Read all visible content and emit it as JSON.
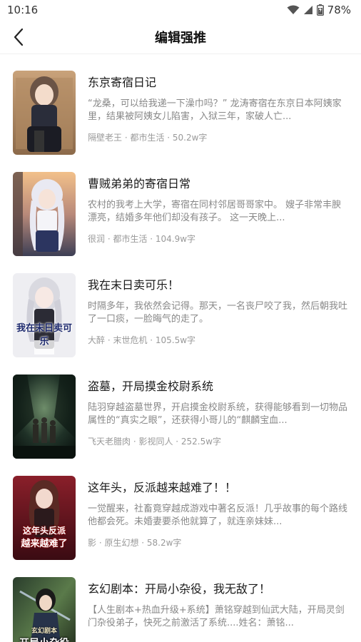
{
  "status": {
    "time": "10:16",
    "battery": "78%"
  },
  "nav": {
    "title": "编辑强推"
  },
  "books": [
    {
      "title": "东京寄宿日记",
      "desc": "“龙桑，可以给我递一下澡巾吗？” 龙涛寄宿在东京日本阿姨家里，结果被阿姨女儿陷害，入狱三年，家破人亡...",
      "meta": "隔壁老王 · 都市生活 · 50.2w字"
    },
    {
      "title": "曹贼弟弟的寄宿日常",
      "desc": "农村的我考上大学，寄宿在同村邻居哥哥家中。 嫂子非常丰腴漂亮，结婚多年他们却没有孩子。 这一天晚上...",
      "meta": "很润 · 都市生活 · 104.9w字"
    },
    {
      "title": "我在末日卖可乐！",
      "desc": "时隔多年，我依然会记得。那天，一名丧尸咬了我，然后朝我吐了一口痰，一脸晦气的走了。",
      "meta": "大醉 · 末世危机 · 105.5w字",
      "cover_text": "我在末日卖可乐"
    },
    {
      "title": "盗墓，开局摸金校尉系统",
      "desc": "陆羽穿越盗墓世界，开启摸金校尉系统，获得能够看到一切物品属性的“真实之眼”，还获得小哥儿的“麒麟宝血...",
      "meta": "飞天老腊肉 · 影视同人 · 252.5w字"
    },
    {
      "title": "这年头，反派越来越难了！！",
      "desc": "一觉醒来，社畜竟穿越成游戏中著名反派！几乎故事的每个路线他都会死。未婚妻要杀他就算了，就连亲妹妹...",
      "meta": "影 · 原生幻想 · 58.2w字",
      "cover_text_1": "这年头反派",
      "cover_text_2": "越来越难了"
    },
    {
      "title": "玄幻剧本：开局小杂役，我无敌了！",
      "desc": "【人生剧本+热血升级+系统】萧铭穿越到仙武大陆，开局灵剑门杂役弟子，快死之前激活了系统....姓名：萧铭...",
      "meta": "",
      "cover_text_1": "玄幻剧本",
      "cover_text_2": "开局小杂役"
    }
  ]
}
